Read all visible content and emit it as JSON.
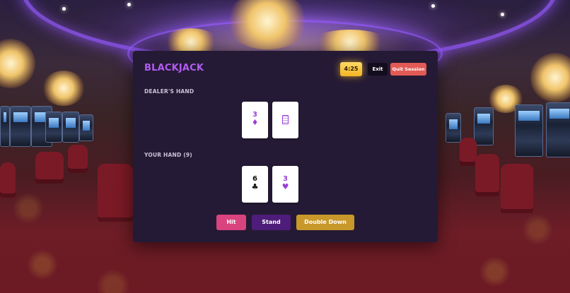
{
  "game": {
    "title": "BLACKJACK",
    "timer": "4:25",
    "exit_label": "Exit",
    "quit_label": "Quit Session"
  },
  "dealer": {
    "label": "DEALER'S HAND",
    "cards": [
      {
        "rank": "3",
        "suit": "♦",
        "color": "#9b3fd8",
        "face_up": true
      },
      {
        "face_up": false
      }
    ]
  },
  "player": {
    "label": "YOUR HAND (9)",
    "cards": [
      {
        "rank": "6",
        "suit": "♣",
        "color": "#111111",
        "face_up": true
      },
      {
        "rank": "3",
        "suit": "♥",
        "color": "#9b3fd8",
        "face_up": true
      }
    ]
  },
  "actions": {
    "hit": "Hit",
    "stand": "Stand",
    "double_down": "Double Down"
  },
  "colors": {
    "title": "#b15cf0",
    "panel": "#251a35",
    "timer": "#f2b422",
    "quit": "#e35a55",
    "hit": "#d9437e",
    "stand": "#4e1c7a",
    "double_down": "#c8982a"
  }
}
